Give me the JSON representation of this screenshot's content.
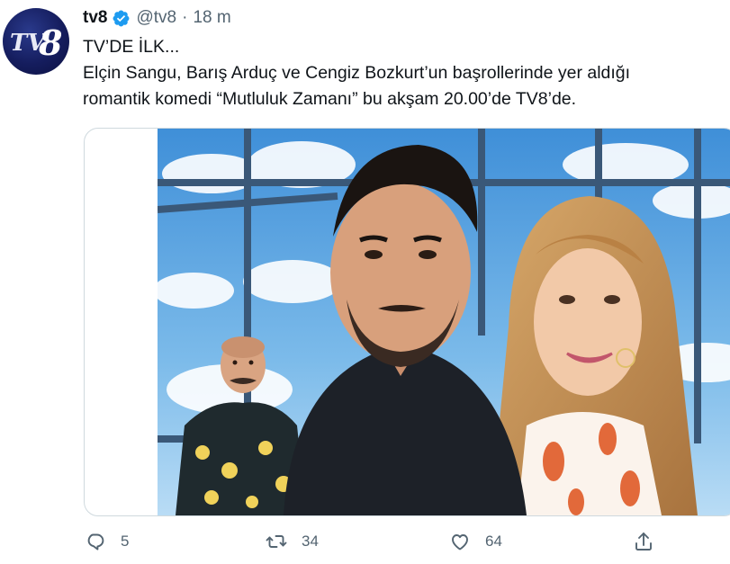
{
  "account": {
    "name": "tv8",
    "handle": "@tv8",
    "separator": "·",
    "time": "18 m",
    "avatar_icon": "tv8-logo-icon",
    "verified_icon": "verified-badge-icon",
    "logo_text": "TV8"
  },
  "tweet": {
    "lines": [
      "TV’DE İLK...",
      "Elçin Sangu, Barış Arduç ve Cengiz Bozkurt’un başrollerinde yer aldığı",
      "romantik komedi “Mutluluk Zamanı” bu akşam 20.00’de TV8’de."
    ]
  },
  "actions": {
    "reply": {
      "icon": "reply-icon",
      "count": "5"
    },
    "retweet": {
      "icon": "retweet-icon",
      "count": "34"
    },
    "like": {
      "icon": "heart-icon",
      "count": "64"
    },
    "share": {
      "icon": "share-icon"
    }
  },
  "colors": {
    "verified": "#1d9bf0",
    "secondary_text": "#536471",
    "sky": "#5aa9e6",
    "frame": "#35506e"
  }
}
